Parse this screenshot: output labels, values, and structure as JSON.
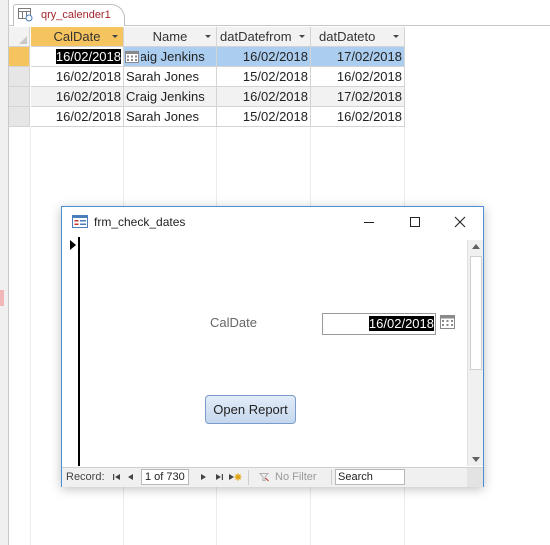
{
  "tab": {
    "label": "qry_calender1"
  },
  "datasheet": {
    "columns": [
      "CalDate",
      "Name",
      "datDatefrom",
      "datDateto"
    ],
    "rows": [
      {
        "caldate": "16/02/2018",
        "name": "Craig Jenkins",
        "from": "16/02/2018",
        "to": "17/02/2018"
      },
      {
        "caldate": "16/02/2018",
        "name": "Sarah Jones",
        "from": "15/02/2018",
        "to": "16/02/2018"
      },
      {
        "caldate": "16/02/2018",
        "name": "Craig Jenkins",
        "from": "16/02/2018",
        "to": "17/02/2018"
      },
      {
        "caldate": "16/02/2018",
        "name": "Sarah Jones",
        "from": "15/02/2018",
        "to": "16/02/2018"
      }
    ]
  },
  "form": {
    "title": "frm_check_dates",
    "caldate_label": "CalDate",
    "caldate_value": "16/02/2018",
    "open_report_label": "Open Report",
    "nav": {
      "record_label": "Record:",
      "position": "1 of 730",
      "filter_label": "No Filter",
      "search_placeholder": "Search"
    }
  },
  "colors": {
    "active_header": "#f6c45e",
    "selected_row": "#aacdf0",
    "tab_text": "#a4262c",
    "window_border": "#4a90d9"
  },
  "icons": [
    "query-icon",
    "form-icon",
    "calendar-icon",
    "minimize-icon",
    "maximize-icon",
    "close-icon",
    "first-record-icon",
    "prev-record-icon",
    "next-record-icon",
    "last-record-icon",
    "new-record-icon",
    "filter-icon"
  ]
}
